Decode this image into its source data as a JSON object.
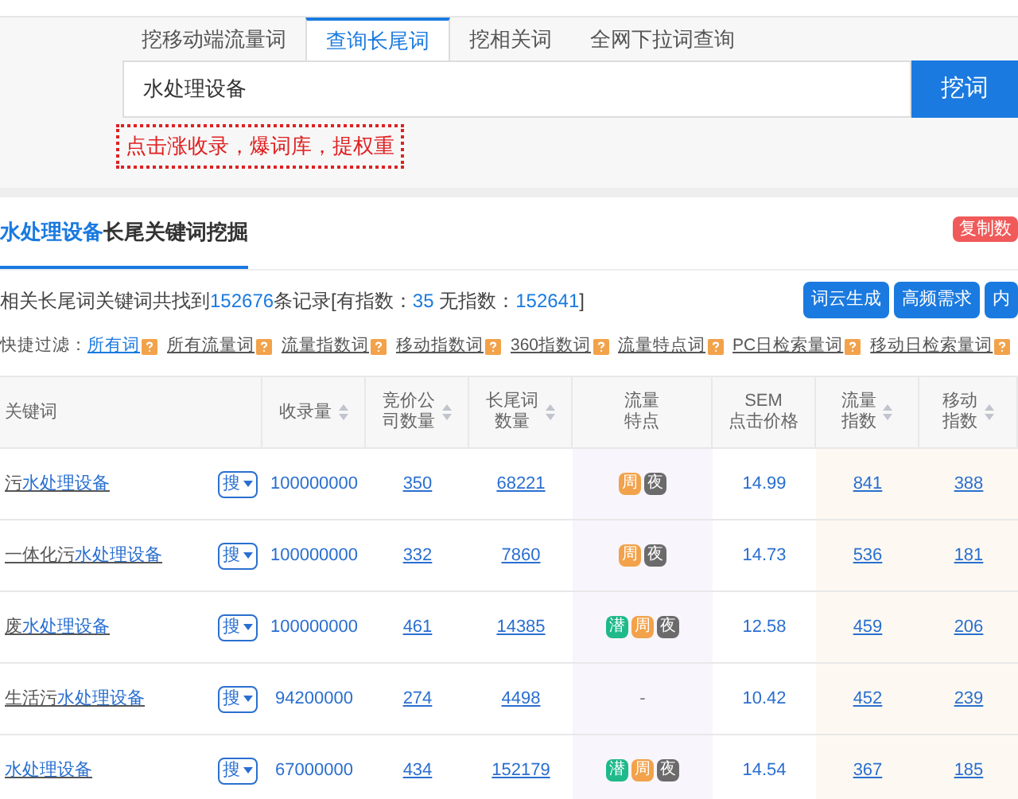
{
  "tabs": [
    {
      "label": "挖移动端流量词",
      "selected": false
    },
    {
      "label": "查询长尾词",
      "selected": true
    },
    {
      "label": "挖相关词",
      "selected": false
    },
    {
      "label": "全网下拉词查询",
      "selected": false
    }
  ],
  "search": {
    "value": "水处理设备",
    "button": "挖词"
  },
  "hint": "点击涨收录，爆词库，提权重",
  "section": {
    "title_match": "水处理设备",
    "title_rest": "长尾关键词挖掘",
    "copy_button": "复制数"
  },
  "summary": {
    "prefix": "相关长尾词关键词共找到",
    "total": "152676",
    "mid": "条记录[有指数：",
    "with_index": "35",
    "sep": "无指数：",
    "without_index": "152641",
    "end": "]"
  },
  "actions": [
    "词云生成",
    "高频需求",
    "内"
  ],
  "filter": {
    "label": "快捷过滤：",
    "items": [
      {
        "label": "所有词",
        "selected": true
      },
      {
        "label": "所有流量词",
        "selected": false
      },
      {
        "label": "流量指数词",
        "selected": false
      },
      {
        "label": "移动指数词",
        "selected": false
      },
      {
        "label": "360指数词",
        "selected": false
      },
      {
        "label": "流量特点词",
        "selected": false
      },
      {
        "label": "PC日检索量词",
        "selected": false
      },
      {
        "label": "移动日检索量词",
        "selected": false
      }
    ]
  },
  "columns": [
    {
      "lines": [
        "关键词"
      ],
      "sortable": false
    },
    {
      "lines": [
        "收录量"
      ],
      "sortable": true
    },
    {
      "lines": [
        "竞价公",
        "司数量"
      ],
      "sortable": true
    },
    {
      "lines": [
        "长尾词",
        "数量"
      ],
      "sortable": true
    },
    {
      "lines": [
        "流量",
        "特点"
      ],
      "sortable": false
    },
    {
      "lines": [
        "SEM",
        "点击价格"
      ],
      "sortable": false
    },
    {
      "lines": [
        "流量",
        "指数"
      ],
      "sortable": true
    },
    {
      "lines": [
        "移动",
        "指数"
      ],
      "sortable": true
    }
  ],
  "rows": [
    {
      "keyword_prefix": "污",
      "keyword_match": "水处理设备",
      "search_label": "搜",
      "indexed": "100000000",
      "bids": "350",
      "longtail": "68221",
      "tags": [
        {
          "label": "周",
          "kind": "weekend"
        },
        {
          "label": "夜",
          "kind": "night"
        }
      ],
      "sem": "14.99",
      "flow": "841",
      "mobile": "388"
    },
    {
      "keyword_prefix": "一体化污",
      "keyword_match": "水处理设备",
      "search_label": "搜",
      "indexed": "100000000",
      "bids": "332",
      "longtail": "7860",
      "tags": [
        {
          "label": "周",
          "kind": "weekend"
        },
        {
          "label": "夜",
          "kind": "night"
        }
      ],
      "sem": "14.73",
      "flow": "536",
      "mobile": "181"
    },
    {
      "keyword_prefix": "废",
      "keyword_match": "水处理设备",
      "search_label": "搜",
      "indexed": "100000000",
      "bids": "461",
      "longtail": "14385",
      "tags": [
        {
          "label": "潜",
          "kind": "potential"
        },
        {
          "label": "周",
          "kind": "weekend"
        },
        {
          "label": "夜",
          "kind": "night"
        }
      ],
      "sem": "12.58",
      "flow": "459",
      "mobile": "206"
    },
    {
      "keyword_prefix": "生活污",
      "keyword_match": "水处理设备",
      "search_label": "搜",
      "indexed": "94200000",
      "bids": "274",
      "longtail": "4498",
      "tags": [],
      "no_tags": "-",
      "sem": "10.42",
      "flow": "452",
      "mobile": "239"
    },
    {
      "keyword_match": "水处理设备",
      "search_label": "搜",
      "indexed": "67000000",
      "bids": "434",
      "longtail": "152179",
      "tags": [
        {
          "label": "潜",
          "kind": "potential"
        },
        {
          "label": "周",
          "kind": "weekend"
        },
        {
          "label": "夜",
          "kind": "night"
        }
      ],
      "sem": "14.54",
      "flow": "367",
      "mobile": "185"
    }
  ]
}
